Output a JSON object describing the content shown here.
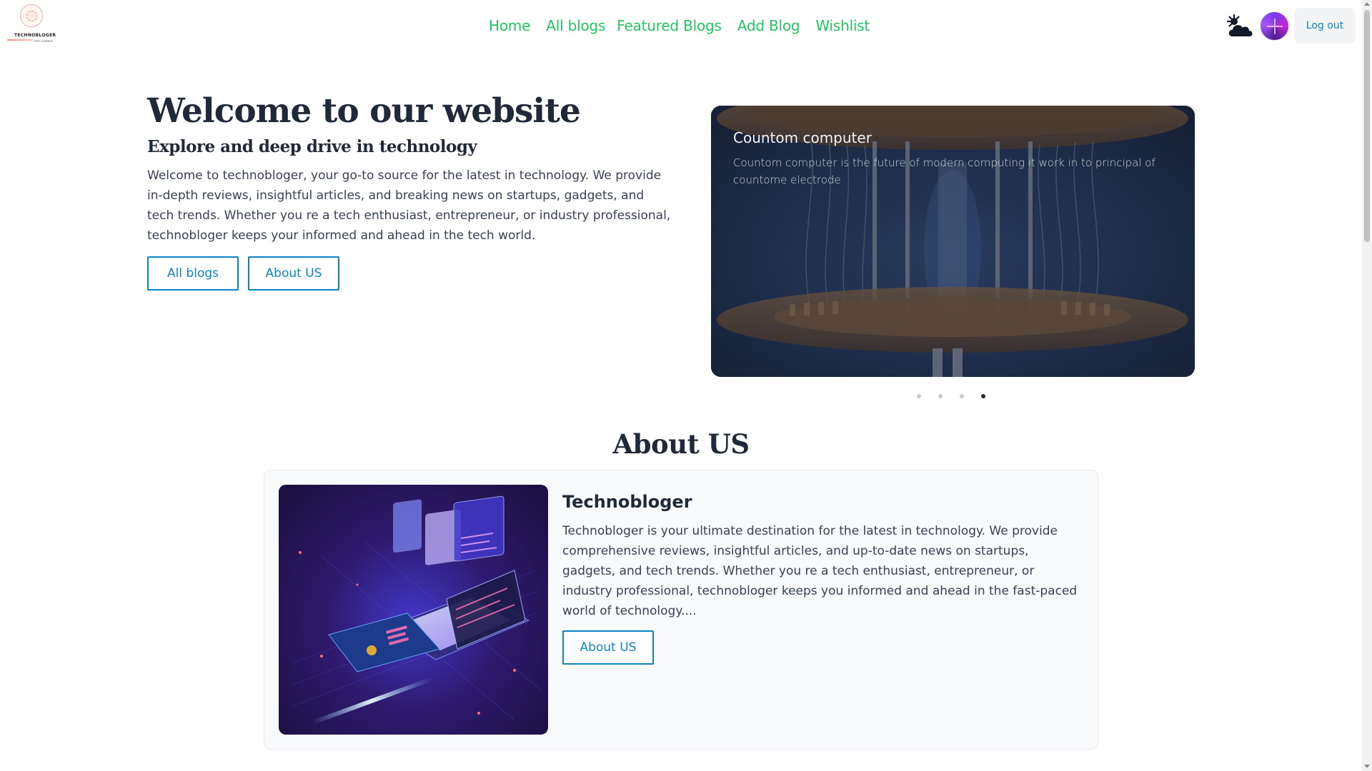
{
  "logo": {
    "name": "TECHNOBLOGER",
    "tagline": "tech content"
  },
  "nav": {
    "links": [
      {
        "label": "Home"
      },
      {
        "label": "All blogs"
      },
      {
        "label": "Featured Blogs"
      },
      {
        "label": "Add Blog"
      },
      {
        "label": "Wishlist"
      }
    ],
    "weather_icon": "cloud-sun-icon",
    "avatar_icon": "user-avatar",
    "logout_label": "Log out"
  },
  "hero": {
    "title": "Welcome to our website",
    "subtitle": "Explore and deep drive in technology",
    "description": "Welcome to technobloger, your go-to source for the latest in technology. We provide in-depth reviews, insightful articles, and breaking news on startups, gadgets, and tech trends. Whether you re a tech enthusiast, entrepreneur, or industry professional, technobloger keeps your informed and ahead in the tech world.",
    "buttons": {
      "all_blogs": "All blogs",
      "about_us": "About US"
    }
  },
  "carousel": {
    "slide": {
      "title": "Countom computer",
      "description": "Countom computer is the future of modern computing it work in to principal of countome electrode"
    },
    "slide_count": 4,
    "active_index": 3
  },
  "about": {
    "heading": "About US",
    "card": {
      "title": "Technobloger",
      "description": "Technobloger is your ultimate destination for the latest in technology. We provide comprehensive reviews, insightful articles, and up-to-date news on startups, gadgets, and tech trends. Whether you re a tech enthusiast, entrepreneur, or industry professional, technobloger keeps you informed and ahead in the fast-paced world of technology....",
      "button": "About US"
    }
  },
  "colors": {
    "nav_link": "#22c55e",
    "accent": "#0b84c6",
    "heading": "#1f2937"
  }
}
